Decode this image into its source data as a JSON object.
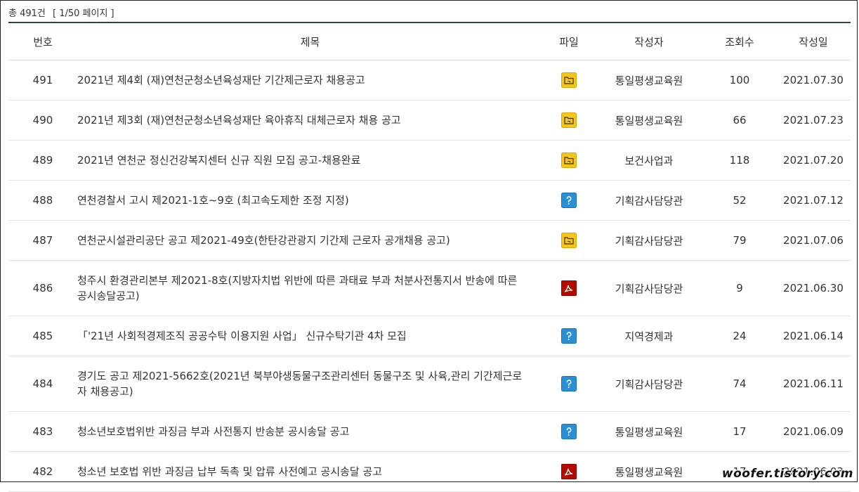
{
  "summary": {
    "total": "총 491건",
    "page": "[ 1/50 페이지 ]"
  },
  "headers": {
    "no": "번호",
    "title": "제목",
    "file": "파일",
    "author": "작성자",
    "views": "조회수",
    "date": "작성일"
  },
  "rows": [
    {
      "no": "491",
      "title": "2021년 제4회 (재)연천군청소년육성재단 기간제근로자 채용공고",
      "file": "folder-icon",
      "author": "통일평생교육원",
      "views": "100",
      "date": "2021.07.30"
    },
    {
      "no": "490",
      "title": "2021년 제3회 (재)연천군청소년육성재단 육아휴직 대체근로자 채용 공고",
      "file": "folder-icon",
      "author": "통일평생교육원",
      "views": "66",
      "date": "2021.07.23"
    },
    {
      "no": "489",
      "title": "2021년 연천군 정신건강복지센터 신규 직원 모집 공고-채용완료",
      "file": "folder-icon",
      "author": "보건사업과",
      "views": "118",
      "date": "2021.07.20"
    },
    {
      "no": "488",
      "title": "연천경찰서 고시 제2021-1호~9호 (최고속도제한 조정 지정)",
      "file": "hwp-icon",
      "author": "기획감사담당관",
      "views": "52",
      "date": "2021.07.12"
    },
    {
      "no": "487",
      "title": "연천군시설관리공단 공고 제2021-49호(한탄강관광지 기간제 근로자 공개채용 공고)",
      "file": "folder-icon",
      "author": "기획감사담당관",
      "views": "79",
      "date": "2021.07.06"
    },
    {
      "no": "486",
      "title": "청주시 환경관리본부 제2021-8호(지방자치법 위반에 따른 과태료 부과 처분사전통지서 반송에 따른 공시송달공고)",
      "file": "pdf-icon",
      "author": "기획감사담당관",
      "views": "9",
      "date": "2021.06.30"
    },
    {
      "no": "485",
      "title": "「'21년 사회적경제조직 공공수탁 이용지원 사업」 신규수탁기관 4차 모집",
      "file": "hwp-icon",
      "author": "지역경제과",
      "views": "24",
      "date": "2021.06.14"
    },
    {
      "no": "484",
      "title": "경기도 공고 제2021-5662호(2021년 북부야생동물구조관리센터 동물구조 및 사육,관리 기간제근로자 채용공고)",
      "file": "hwp-icon",
      "author": "기획감사담당관",
      "views": "74",
      "date": "2021.06.11"
    },
    {
      "no": "483",
      "title": "청소년보호법위반 과징금 부과 사전통지 반송분 공시송달 공고",
      "file": "hwp-icon",
      "author": "통일평생교육원",
      "views": "17",
      "date": "2021.06.09"
    },
    {
      "no": "482",
      "title": "청소년 보호법 위반 과징금 납부 독촉 및 압류 사전예고 공시송달 공고",
      "file": "pdf-icon",
      "author": "통일평생교육원",
      "views": "17",
      "date": "2021.06.03"
    }
  ],
  "watermark": "woofer.tistory.com"
}
